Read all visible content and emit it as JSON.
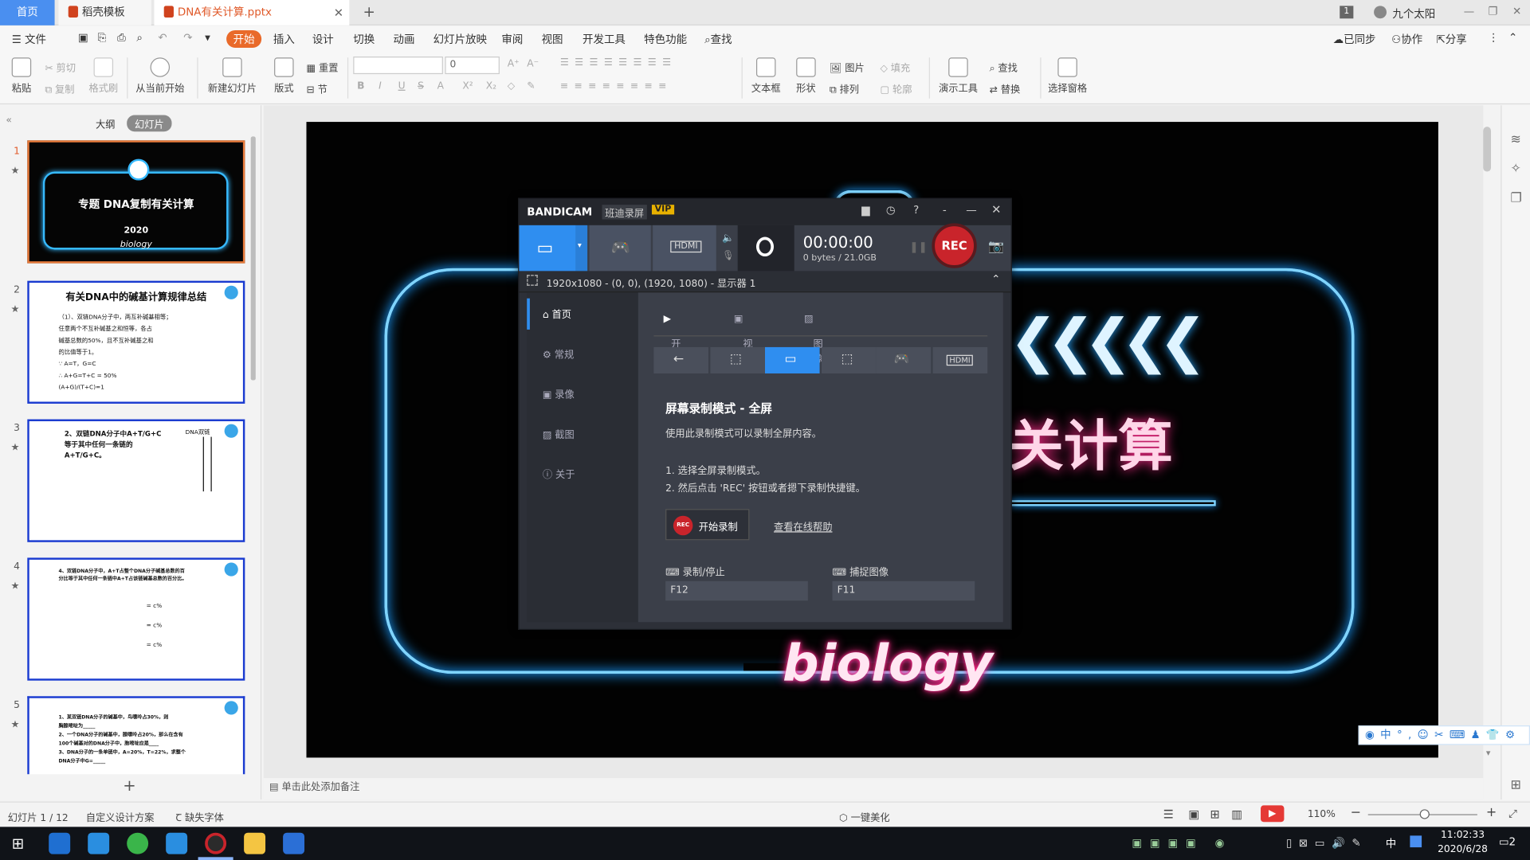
{
  "tabs": {
    "home": "首页",
    "t2": "稻壳模板",
    "t3": "DNA有关计算.pptx",
    "new": "+"
  },
  "user": {
    "badge": "1",
    "name": "九个太阳"
  },
  "menu": {
    "file": "文件",
    "items": [
      "开始",
      "插入",
      "设计",
      "切换",
      "动画",
      "幻灯片放映",
      "审阅",
      "视图",
      "开发工具",
      "特色功能"
    ],
    "search": "查找",
    "synced": "已同步",
    "collab": "协作",
    "share": "分享"
  },
  "ribbon": {
    "paste": "粘贴",
    "cut": "剪切",
    "copy": "复制",
    "format_painter": "格式刷",
    "from_current": "从当前开始",
    "new_slide": "新建幻灯片",
    "layout": "版式",
    "reset": "重置",
    "section": "节",
    "font_size": "0",
    "textbox": "文本框",
    "shapes": "形状",
    "picture": "图片",
    "fill": "填充",
    "arrange": "排列",
    "outline": "轮廓",
    "present_tools": "演示工具",
    "find": "查找",
    "replace": "替换",
    "select_pane": "选择窗格"
  },
  "leftpane": {
    "outline_tab": "大纲",
    "slides_tab": "幻灯片",
    "add": "+"
  },
  "thumbs": [
    {
      "num": "1",
      "title": "专题 DNA复制有关计算",
      "year": "2020",
      "sub": "biology"
    },
    {
      "num": "2",
      "title": "有关DNA中的碱基计算规律总结",
      "lines": [
        "（1）、双链DNA分子中，两互补碱基相等；",
        "任意两个不互补碱基之和恒等，各占",
        "碱基总数的50%，且不互补碱基之和",
        "的比值等于1。",
        "∵ A=T，G=C",
        "∴ A+G=T+C = 50%",
        "(A+G)/(T+C)=1"
      ]
    },
    {
      "num": "3",
      "lines": [
        "2、双链DNA分子中A+T/G+C",
        "等于其中任何一条链的",
        "A+T/G+C。",
        "DNA双链"
      ]
    },
    {
      "num": "4",
      "lines": [
        "4、双链DNA分子中，A+T占整个DNA分子碱基总数的百",
        "分比等于其中任何一条链中A+T占该链碱基总数的百分比。",
        "= c%",
        "= c%",
        "= c%"
      ]
    },
    {
      "num": "5",
      "lines": [
        "1、某双链DNA分子的碱基中，鸟嘌呤占30%，则",
        "胸腺嘧啶为_____",
        "2、一个DNA分子的碱基中，腺嘌呤占20%，那么在含有",
        "100个碱基对的DNA分子中，胞嘧啶应是____",
        "3、DNA分子的一条单链中，A=20%，T=22%，求整个",
        "DNA分子中G=_____"
      ]
    }
  ],
  "slide": {
    "biology": "biology",
    "calc": "关计算"
  },
  "notes": "单击此处添加备注",
  "status": {
    "slide": "幻灯片 1 / 12",
    "theme": "自定义设计方案",
    "font": "缺失字体",
    "beautify": "一键美化",
    "zoom": "110%"
  },
  "taskbar": {
    "time": "11:02:33",
    "date": "2020/6/28",
    "ime": "中",
    "notif": "2"
  },
  "bandicam": {
    "brand": "BANDICAM",
    "brand_cn": "班迪录屏",
    "vip": "VIP",
    "timer": "00:00:00",
    "size": "0 bytes / 21.0GB",
    "rec": "REC",
    "area": "1920x1080 - (0, 0), (1920, 1080) - 显示器 1",
    "nav": [
      "首页",
      "常规",
      "录像",
      "截图",
      "关于"
    ],
    "tabs": [
      "开始",
      "视频",
      "图像"
    ],
    "mode_title": "屏幕录制模式 - 全屏",
    "mode_desc": "使用此录制模式可以录制全屏内容。",
    "step1": "1. 选择全屏录制模式。",
    "step2": "2. 然后点击 'REC' 按钮或者摁下录制快捷键。",
    "start_btn": "开始录制",
    "help_link": "查看在线帮助",
    "hk1_label": "录制/停止",
    "hk1": "F12",
    "hk2_label": "捕捉图像",
    "hk2": "F11"
  }
}
